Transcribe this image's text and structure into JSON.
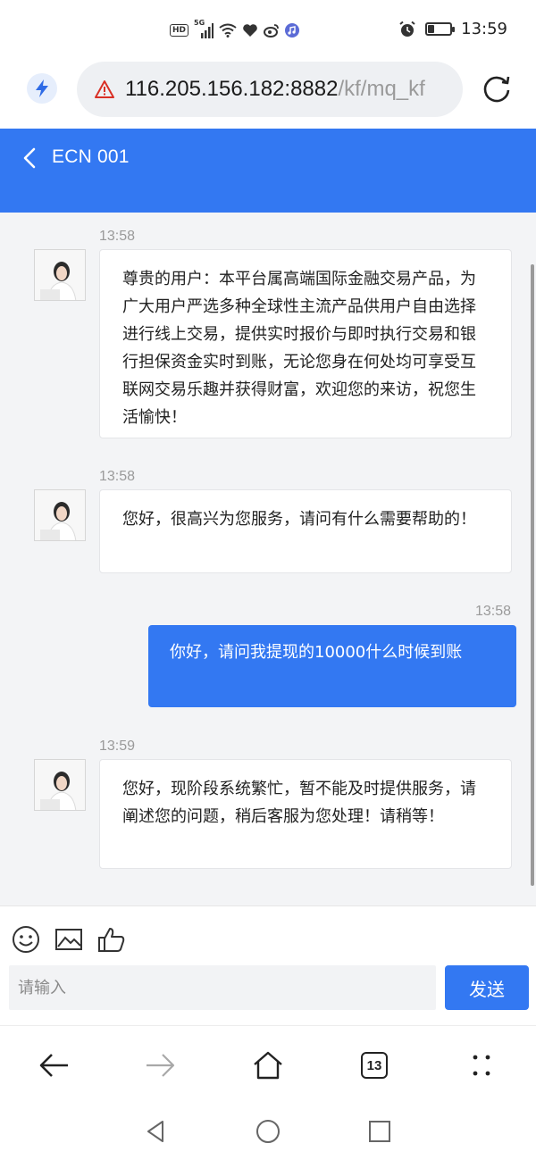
{
  "status_bar": {
    "network_label": "HD",
    "signal_label": "5G",
    "time": "13:59"
  },
  "browser": {
    "url_host": "116.205.156.182:8882",
    "url_path": "/kf/mq_kf",
    "tab_count": "13"
  },
  "chat": {
    "title": "ECN 001",
    "messages": [
      {
        "side": "left",
        "time": "13:58",
        "text": "尊贵的用户：本平台属高端国际金融交易产品，为广大用户严选多种全球性主流产品供用户自由选择进行线上交易，提供实时报价与即时执行交易和银行担保资金实时到账，无论您身在何处均可享受互联网交易乐趣并获得财富，欢迎您的来访，祝您生活愉快！"
      },
      {
        "side": "left",
        "time": "13:58",
        "text": "您好，很高兴为您服务，请问有什么需要帮助的！"
      },
      {
        "side": "right",
        "time": "13:58",
        "text": "你好，请问我提现的10000什么时候到账"
      },
      {
        "side": "left",
        "time": "13:59",
        "text": "您好，现阶段系统繁忙，暂不能及时提供服务，请阐述您的问题，稍后客服为您处理！请稍等！"
      }
    ]
  },
  "composer": {
    "placeholder": "请输入",
    "send_label": "发送"
  },
  "colors": {
    "accent": "#3378f2",
    "chat_bg": "#f3f4f6"
  },
  "icons": [
    "bolt-icon",
    "warning-icon",
    "reload-icon",
    "chevron-left-icon",
    "emoji-icon",
    "image-icon",
    "thumbs-up-icon",
    "arrow-back-icon",
    "arrow-forward-icon",
    "home-icon",
    "menu-dots-icon"
  ]
}
